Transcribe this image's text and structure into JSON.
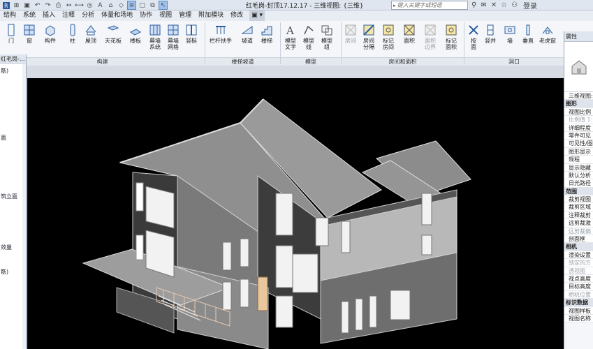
{
  "title_bar": {
    "document_title": "红毛岗-封顶17.12.17 - 三维视图: {三维}",
    "search_placeholder": "键入关键字或短语",
    "signin_label": "登录",
    "qat_icons": [
      "revit-logo-icon",
      "open-icon",
      "save-icon",
      "undo-icon",
      "redo-icon",
      "print-icon",
      "measure-icon",
      "dimension-icon",
      "tag-icon",
      "text-icon",
      "3d-view-icon",
      "section-icon",
      "thin-lines-icon",
      "close-hidden-icon",
      "switch-windows-icon",
      "select-icon"
    ],
    "right_icons": [
      "search-icon",
      "communication-icon",
      "exchange-icon",
      "favorites-icon",
      "user-icon"
    ]
  },
  "tabs": [
    "结构",
    "系统",
    "插入",
    "注释",
    "分析",
    "体量和场地",
    "协作",
    "视图",
    "管理",
    "附加模块",
    "修改"
  ],
  "ribbon": {
    "groups": [
      "构建",
      "楼梯坡道",
      "模型",
      "房间和面积",
      "洞口"
    ],
    "buttons": {
      "door": "门",
      "window": "窗",
      "component": "构件",
      "column": "柱",
      "roof": "屋顶",
      "ceiling": "天花板",
      "floor": "楼板",
      "curtain_system_1": "幕墙",
      "curtain_system_2": "系统",
      "curtain_grid_1": "幕墙",
      "curtain_grid_2": "网格",
      "mullion": "竖梃",
      "railing": "栏杆扶手",
      "ramp": "坡道",
      "stair": "楼梯",
      "model_text_1": "模型",
      "model_text_2": "文字",
      "model_line_1": "模型",
      "model_line_2": "线",
      "model_group_1": "模型",
      "model_group_2": "组",
      "room": "房间",
      "room_sep_1": "房间",
      "room_sep_2": "分隔",
      "tag_room_1": "标记",
      "tag_room_2": "房间",
      "area": "面积",
      "area_boundary_1": "面积",
      "area_boundary_2": "边界",
      "tag_area_1": "标记",
      "tag_area_2": "面积",
      "by_face_1": "按",
      "by_face_2": "面",
      "shaft": "竖井",
      "wall_opening": "墙",
      "vertical": "垂直",
      "dormer": "老虎窗"
    }
  },
  "left_panel": {
    "header": "红毛岗-...",
    "items": [
      "筋)",
      "面",
      "筑立面",
      "效量",
      "筋)"
    ]
  },
  "right_panel": {
    "header": "属性",
    "rows": [
      {
        "label": "三维视图: {",
        "kind": "item"
      },
      {
        "label": "图形",
        "kind": "cat"
      },
      {
        "label": "视图比例",
        "kind": "item"
      },
      {
        "label": "比例值 1:",
        "kind": "dim"
      },
      {
        "label": "详细程度",
        "kind": "item"
      },
      {
        "label": "零件可见",
        "kind": "item"
      },
      {
        "label": "可见性/图",
        "kind": "item"
      },
      {
        "label": "图形显示",
        "kind": "item"
      },
      {
        "label": "规程",
        "kind": "item"
      },
      {
        "label": "显示隐藏",
        "kind": "item"
      },
      {
        "label": "默认分析",
        "kind": "item"
      },
      {
        "label": "日光路径",
        "kind": "item"
      },
      {
        "label": "范围",
        "kind": "cat"
      },
      {
        "label": "裁剪视图",
        "kind": "item"
      },
      {
        "label": "裁剪区域",
        "kind": "item"
      },
      {
        "label": "注释裁剪",
        "kind": "item"
      },
      {
        "label": "远剪裁激",
        "kind": "item"
      },
      {
        "label": "远剪裁偏",
        "kind": "dim"
      },
      {
        "label": "剖面框",
        "kind": "item"
      },
      {
        "label": "相机",
        "kind": "cat"
      },
      {
        "label": "渲染设置",
        "kind": "item"
      },
      {
        "label": "锁定的方",
        "kind": "dim"
      },
      {
        "label": "透视图",
        "kind": "dim"
      },
      {
        "label": "视点高度",
        "kind": "item"
      },
      {
        "label": "目标高度",
        "kind": "item"
      },
      {
        "label": "相机位置",
        "kind": "dim"
      },
      {
        "label": "标识数据",
        "kind": "cat"
      },
      {
        "label": "视图样板",
        "kind": "item"
      },
      {
        "label": "视图名称",
        "kind": "item"
      }
    ]
  },
  "colors": {
    "viewport_bg": "#000000",
    "roof": "#8f8f8f",
    "wall_dark": "#3a3a3a",
    "wall_light": "#7a7a7a",
    "ribbon_bg": "#f4f6f9",
    "accent": "#5f8cc4"
  }
}
